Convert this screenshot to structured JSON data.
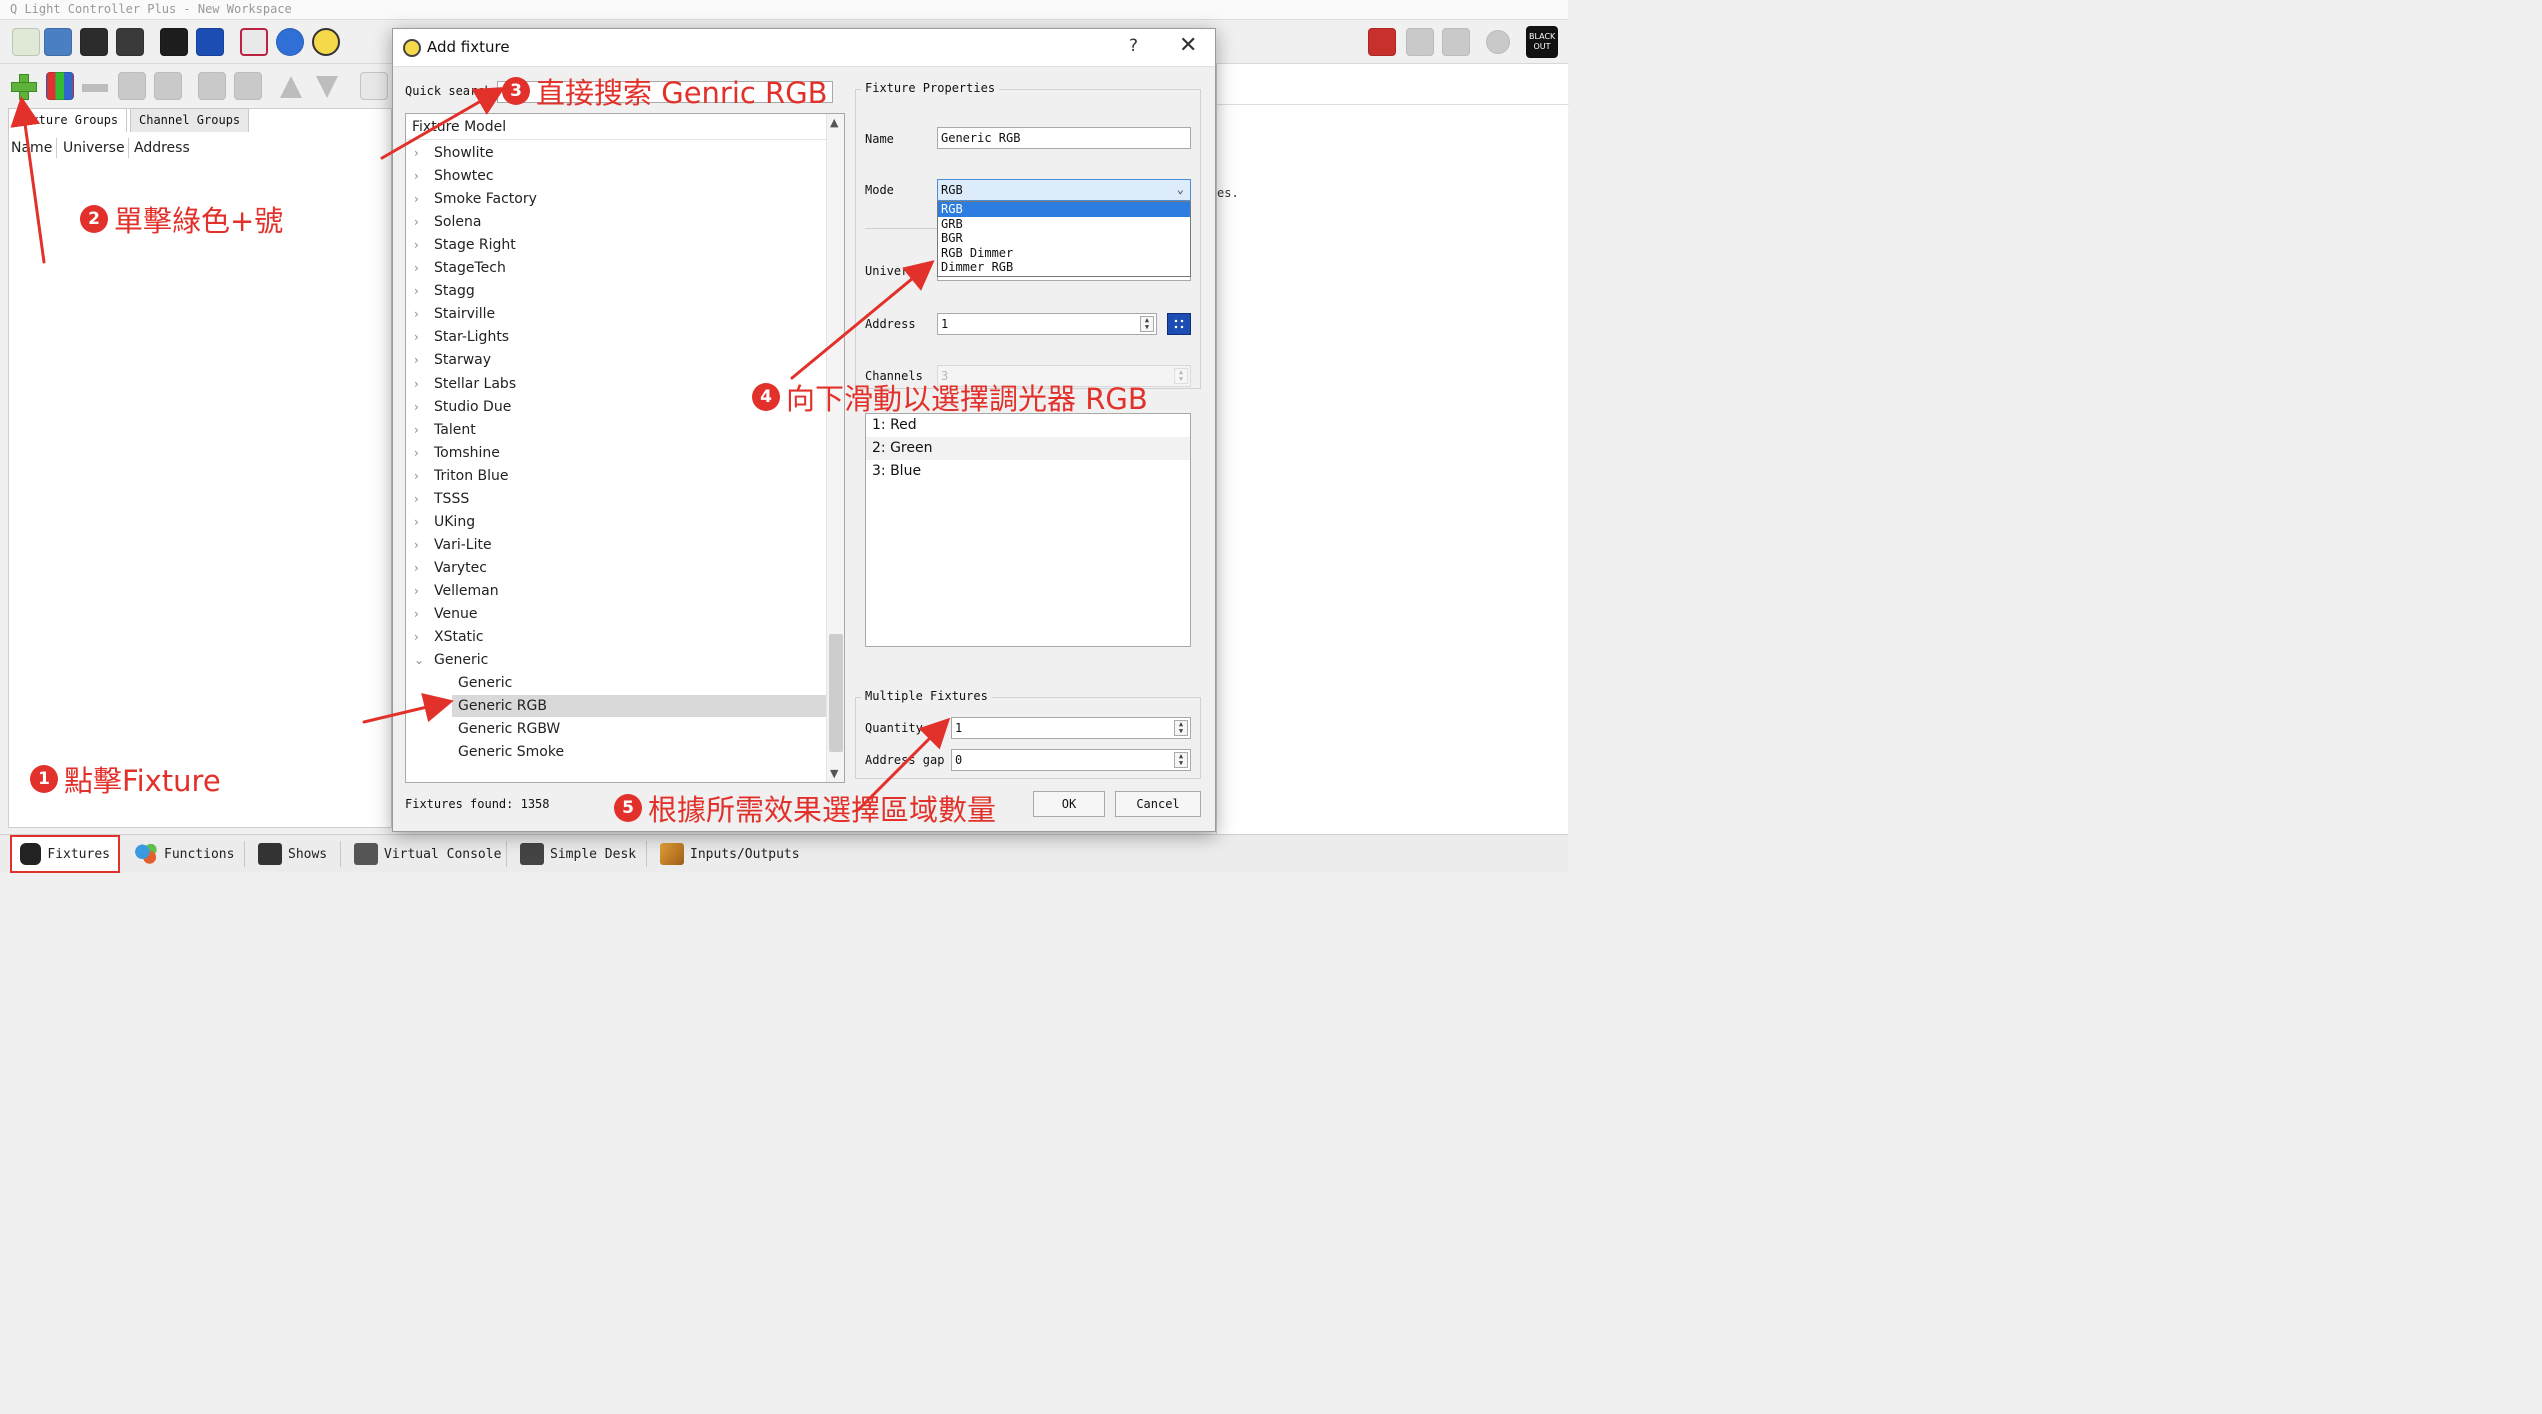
{
  "window": {
    "title": "Q Light Controller Plus - New Workspace"
  },
  "left_panel": {
    "tabs": [
      "Fixture Groups",
      "Channel Groups"
    ],
    "columns": [
      "Name",
      "Universe",
      "Address"
    ]
  },
  "right_panel": {
    "partial_text": "es."
  },
  "bottom_tabs": [
    "Fixtures",
    "Functions",
    "Shows",
    "Virtual Console",
    "Simple Desk",
    "Inputs/Outputs"
  ],
  "toolbar_right": {
    "blackout_label": "BLACK OUT"
  },
  "dialog": {
    "title": "Add fixture",
    "help": "?",
    "close": "✕",
    "quick_search_label": "Quick search",
    "quick_search_value": "",
    "tree_header": "Fixture Model",
    "manufacturers": [
      "Showlite",
      "Showtec",
      "Smoke Factory",
      "Solena",
      "Stage Right",
      "StageTech",
      "Stagg",
      "Stairville",
      "Star-Lights",
      "Starway",
      "Stellar Labs",
      "Studio Due",
      "Talent",
      "Tomshine",
      "Triton Blue",
      "TSSS",
      "UKing",
      "Vari-Lite",
      "Varytec",
      "Velleman",
      "Venue",
      "XStatic"
    ],
    "expanded_manufacturer": "Generic",
    "generic_models": [
      "Generic",
      "Generic RGB",
      "Generic RGBW",
      "Generic Smoke"
    ],
    "selected_model": "Generic RGB",
    "fixtures_found": "Fixtures found: 1358",
    "properties": {
      "group_title": "Fixture Properties",
      "name_label": "Name",
      "name_value": "Generic RGB",
      "mode_label": "Mode",
      "mode_value": "RGB",
      "mode_options": [
        "RGB",
        "GRB",
        "BGR",
        "RGB Dimmer",
        "Dimmer RGB"
      ],
      "universe_label": "Universe",
      "address_label": "Address",
      "address_value": "1",
      "channels_label": "Channels",
      "channels_value": "3",
      "channel_list": [
        "1: Red",
        "2: Green",
        "3: Blue"
      ]
    },
    "multiple": {
      "group_title": "Multiple Fixtures",
      "quantity_label": "Quantity",
      "quantity_value": "1",
      "gap_label": "Address gap",
      "gap_value": "0"
    },
    "ok_label": "OK",
    "cancel_label": "Cancel"
  },
  "annotations": [
    {
      "num": "1",
      "text": "點擊Fixture"
    },
    {
      "num": "2",
      "text": "單擊綠色+號"
    },
    {
      "num": "3",
      "text": "直接搜索 Genric RGB"
    },
    {
      "num": "4",
      "text": "向下滑動以選擇調光器 RGB"
    },
    {
      "num": "5",
      "text": "根據所需效果選擇區域數量"
    }
  ],
  "colors": {
    "annotation_red": "#e2312a",
    "selection_blue": "#2d7ce0",
    "plus_green": "#5fb23a"
  }
}
